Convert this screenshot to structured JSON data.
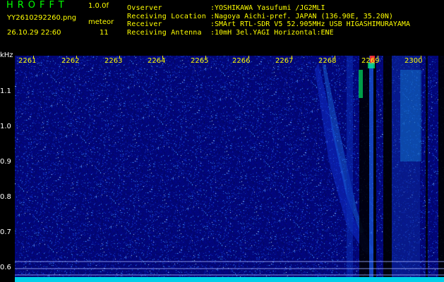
{
  "header": {
    "logo": "HROFFT",
    "version": "1.0.0f",
    "file_name": "YY2610292260.png",
    "datetime": "26.10.29 22:60",
    "meteor_label": "meteor",
    "meteor_count": "11"
  },
  "station_info": [
    {
      "label": "Ovserver",
      "value": ":YOSHIKAWA Yasufumi /JG2MLI"
    },
    {
      "label": "Receiving Location",
      "value": ":Nagoya Aichi-pref. JAPAN (136.90E, 35.20N)"
    },
    {
      "label": "Receiver",
      "value": ":SMArt RTL-SDR V5 52.905MHz USB HIGASHIMURAYAMA"
    },
    {
      "label": "Receiving Antenna",
      "value": ":10mH 3el.YAGI Horizontal:ENE"
    }
  ],
  "axis": {
    "y_unit": "kHz",
    "y_ticks": [
      "1.1",
      "1.0",
      "0.9",
      "0.8",
      "0.7",
      "0.6"
    ],
    "time_ticks": [
      "2261",
      "2262",
      "2263",
      "2264",
      "2265",
      "2266",
      "2267",
      "2268",
      "2269",
      "2300"
    ]
  },
  "colors": {
    "background": "#000000",
    "spectrogram_bg": "#02066a",
    "header_yellow": "#ffff00",
    "header_green": "#00ff00",
    "signal_cyan": "#00e5ff"
  }
}
